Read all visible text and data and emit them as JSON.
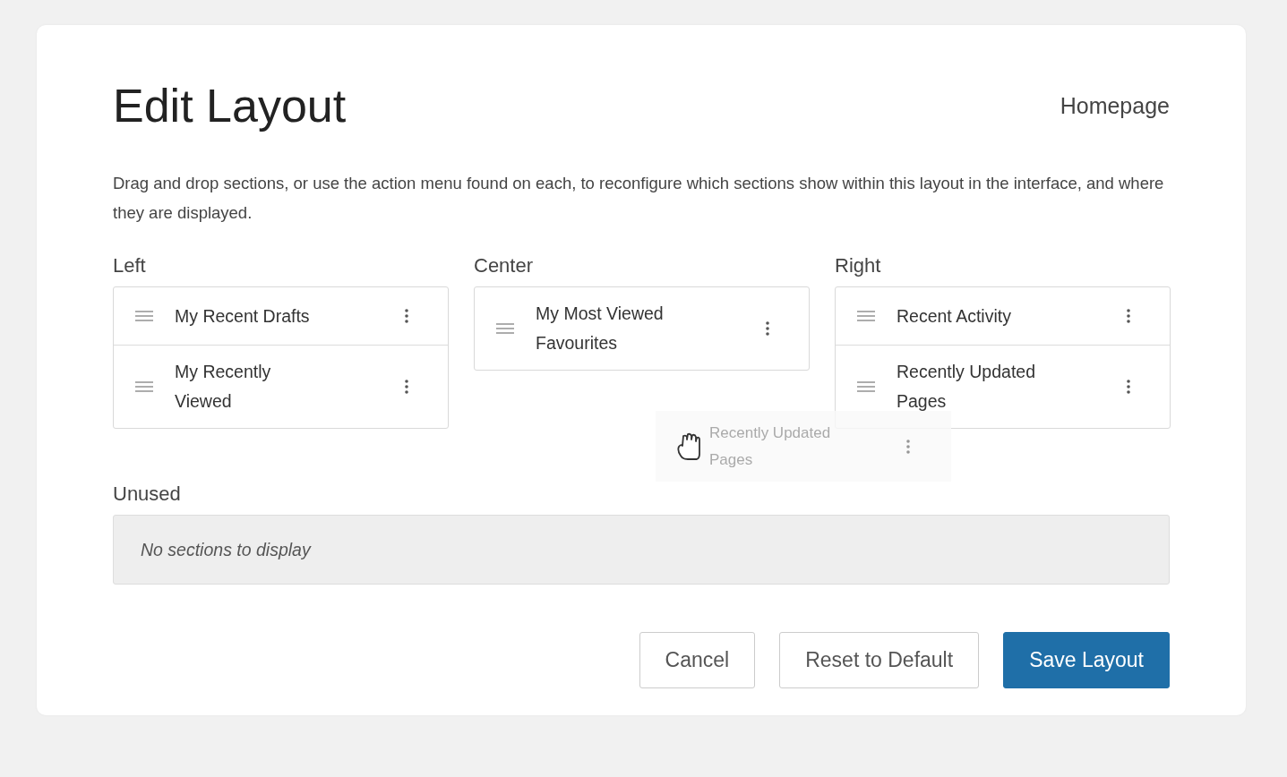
{
  "dialog": {
    "title": "Edit Layout",
    "context": "Homepage",
    "description": "Drag and drop sections, or use the action menu found on each, to reconfigure which sections show within this layout in the interface, and where they are displayed.",
    "columns": [
      {
        "label": "Left",
        "sections": [
          {
            "label": "My Recent Drafts"
          },
          {
            "label": "My Recently Viewed"
          }
        ]
      },
      {
        "label": "Center",
        "sections": [
          {
            "label": "My Most Viewed Favourites"
          }
        ]
      },
      {
        "label": "Right",
        "sections": [
          {
            "label": "Recent Activity"
          },
          {
            "label": "Recently Updated Pages"
          }
        ]
      }
    ],
    "drag_preview": {
      "label": "Recently Updated Pages"
    },
    "unused": {
      "label": "Unused",
      "empty_text": "No sections to display"
    },
    "buttons": [
      {
        "label": "Cancel",
        "kind": "secondary"
      },
      {
        "label": "Reset to Default",
        "kind": "secondary"
      },
      {
        "label": "Save Layout",
        "kind": "primary"
      }
    ]
  }
}
